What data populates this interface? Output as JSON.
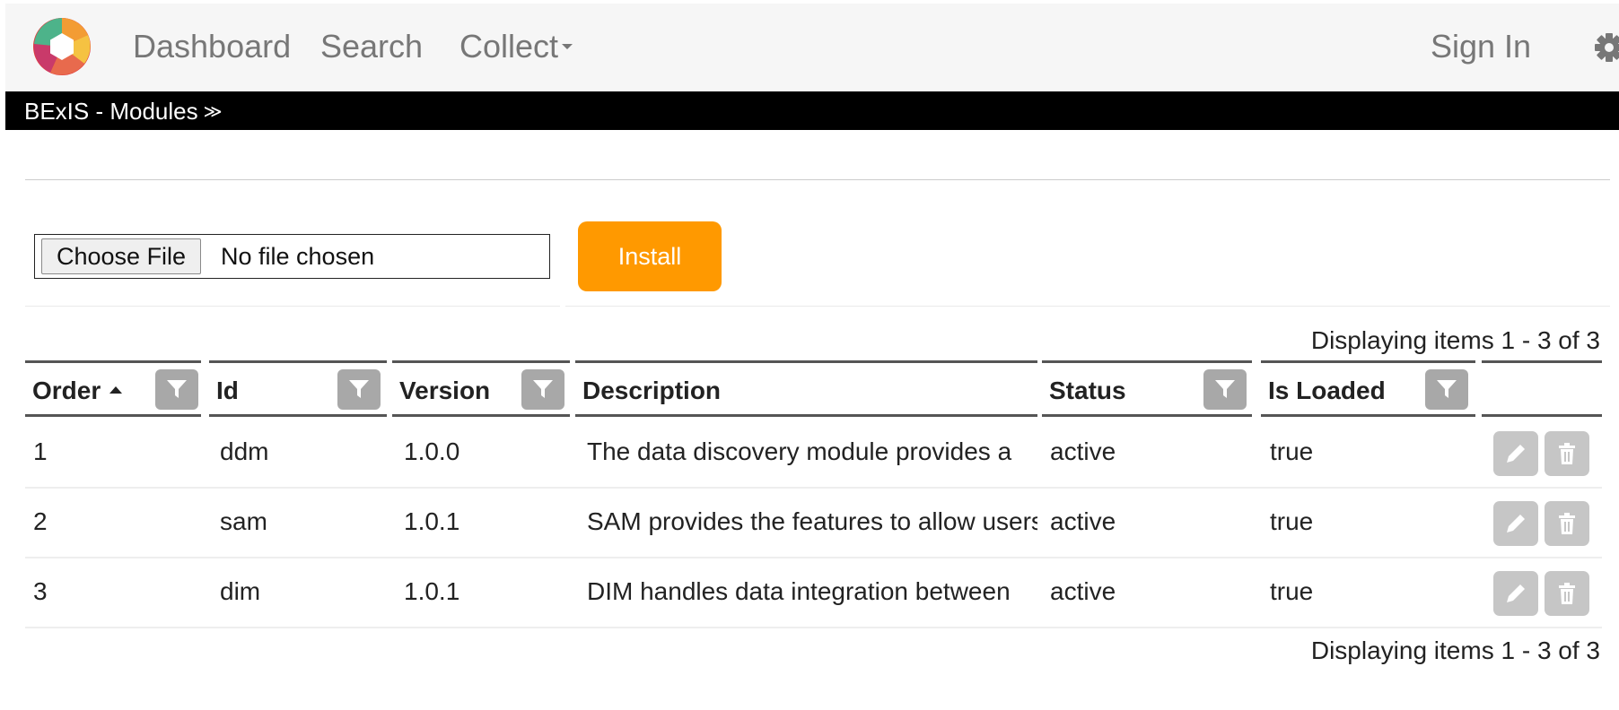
{
  "nav": {
    "links": [
      "Dashboard",
      "Search",
      "Collect"
    ],
    "sign_in": "Sign In"
  },
  "subbar": {
    "title": "BExIS - Modules",
    "toggle_glyph": "≫"
  },
  "upload": {
    "choose_label": "Choose File",
    "no_file": "No file chosen",
    "install_label": "Install"
  },
  "pager": {
    "top": "Displaying items 1 - 3 of 3",
    "bottom": "Displaying items 1 - 3 of 3"
  },
  "table": {
    "columns": [
      "Order",
      "Id",
      "Version",
      "Description",
      "Status",
      "Is Loaded",
      ""
    ],
    "sorted_column": "Order",
    "sort_direction": "ascending",
    "rows": [
      {
        "order": "1",
        "id": "ddm",
        "version": "1.0.0",
        "description": "The data discovery module provides a",
        "status": "active",
        "loaded": "true"
      },
      {
        "order": "2",
        "id": "sam",
        "version": "1.0.1",
        "description": "SAM provides the features to allow users",
        "status": "active",
        "loaded": "true"
      },
      {
        "order": "3",
        "id": "dim",
        "version": "1.0.1",
        "description": "DIM handles data integration between",
        "status": "active",
        "loaded": "true"
      }
    ]
  },
  "icons": {
    "logo": "app-logo",
    "settings": "gear-icon",
    "filter": "filter-icon",
    "edit": "pencil-icon",
    "delete": "trash-icon"
  },
  "colors": {
    "accent": "#ff9900",
    "navbar": "#f6f6f6",
    "subbar": "#000000",
    "filter_button": "#a8a8a8",
    "action_button": "#c6c6c6"
  }
}
